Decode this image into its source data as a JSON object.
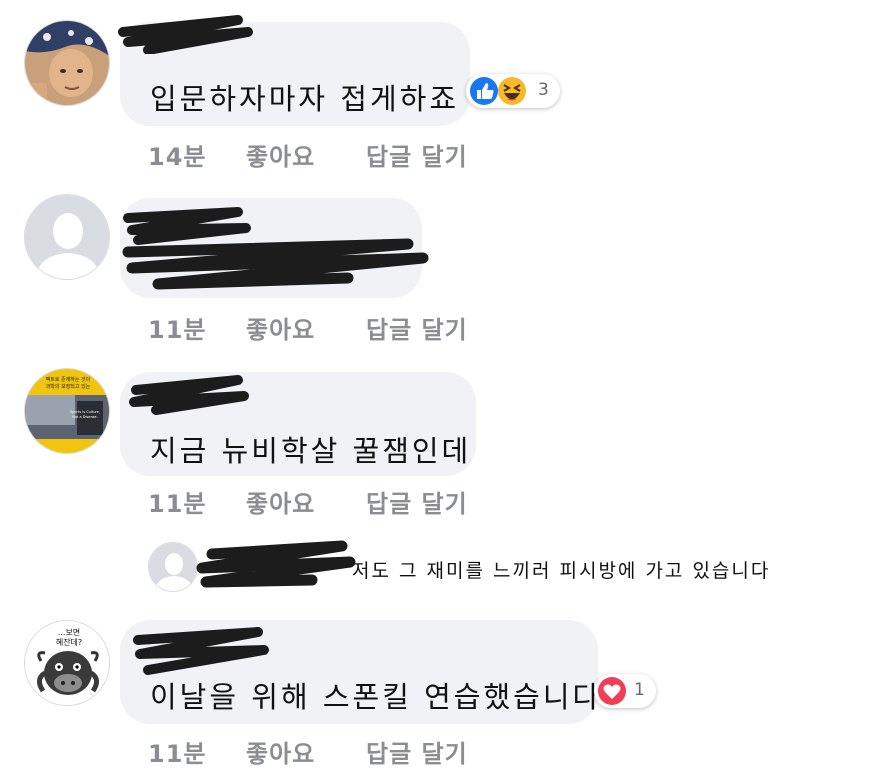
{
  "comments": [
    {
      "text": "입문하자마자 접게하죠",
      "time": "14분",
      "like": "좋아요",
      "reply": "답글 달기",
      "reaction": {
        "icons": [
          "like-icon",
          "haha-icon"
        ],
        "count": "3"
      }
    },
    {
      "text": "",
      "time": "11분",
      "like": "좋아요",
      "reply": "답글 달기"
    },
    {
      "text": "지금 뉴비학살 꿀잼인데",
      "time": "11분",
      "like": "좋아요",
      "reply": "답글 달기",
      "reply_preview": {
        "text": "저도 그 재미를 느끼러 피시방에 가고 있습니다"
      },
      "avatar_text": [
        "팩트로 존재하는 것이",
        "과학의 보장되고 있는",
        "Sports is Culture,",
        "Not a Disease."
      ]
    },
    {
      "text": "이날을 위해 스폰킬 연습했습니다",
      "time": "11분",
      "like": "좋아요",
      "reply": "답글 달기",
      "reaction": {
        "icons": [
          "love-icon"
        ],
        "count": "1"
      },
      "avatar_text": [
        "...보면",
        "혜잔데?"
      ]
    }
  ],
  "colors": {
    "bubble": "#f0f2f5",
    "meta": "#8a8d91",
    "like_blue": "#1877f2",
    "haha_yellow": "#f7b928",
    "love_red": "#f33e58"
  }
}
